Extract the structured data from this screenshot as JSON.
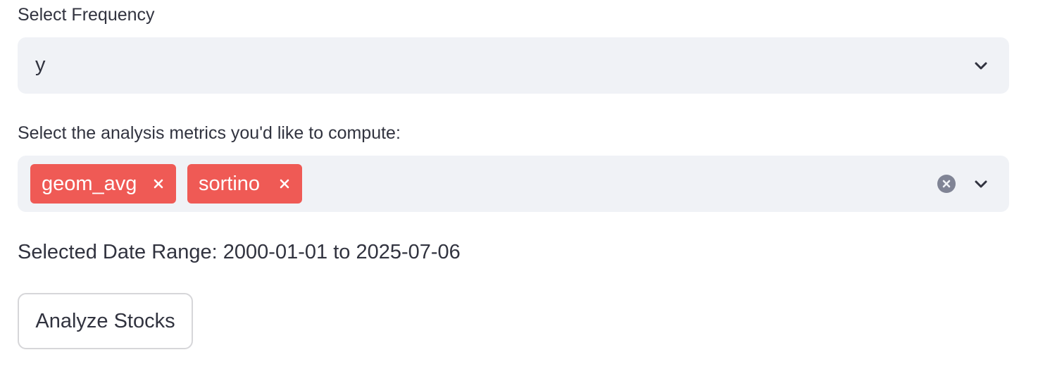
{
  "frequency": {
    "label": "Select Frequency",
    "selected_value": "y",
    "icon": "chevron-down-icon"
  },
  "metrics": {
    "label": "Select the analysis metrics you'd like to compute:",
    "selected": [
      {
        "label": "geom_avg"
      },
      {
        "label": "sortino"
      }
    ],
    "tag_color": "#ef5a55",
    "clear_icon": "clear-circle-icon",
    "dropdown_icon": "chevron-down-icon"
  },
  "date_range": {
    "text": "Selected Date Range: 2000-01-01 to 2025-07-06"
  },
  "analyze_button": {
    "label": "Analyze Stocks"
  },
  "colors": {
    "text": "#31333f",
    "input_background": "#f0f2f6",
    "tag_background": "#ef5a55",
    "button_border": "#d6d6d9"
  }
}
